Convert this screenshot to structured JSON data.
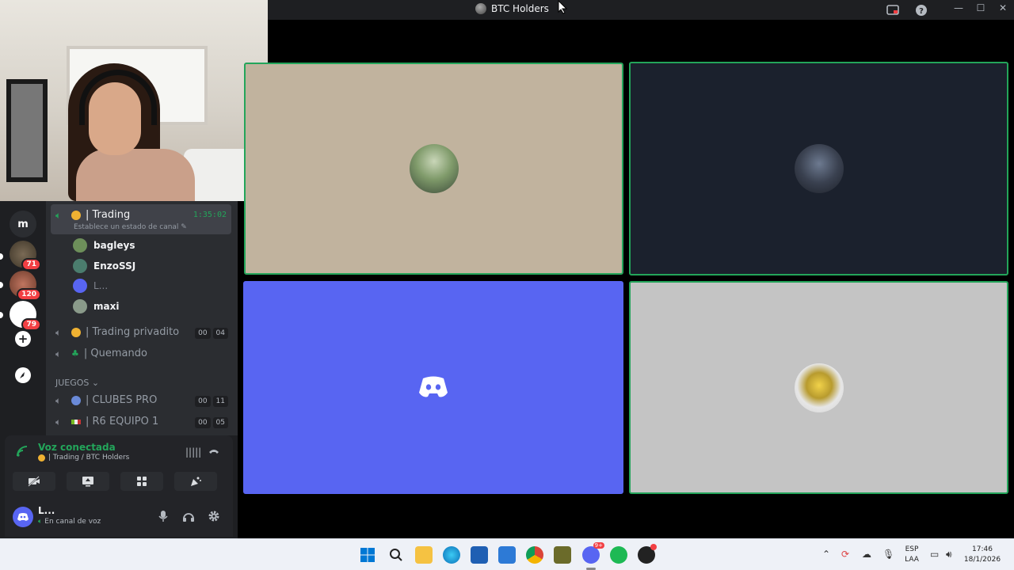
{
  "window": {
    "title": "BTC Holders"
  },
  "servers": [
    {
      "name": "server-m",
      "label": "m"
    },
    {
      "name": "server-71",
      "badge": "71"
    },
    {
      "name": "server-120",
      "badge": "120"
    },
    {
      "name": "server-79",
      "badge": "79"
    }
  ],
  "channels": {
    "active": {
      "name": "Trading",
      "timer": "1:35:02",
      "status": "Establece un estado de canal"
    },
    "users": [
      {
        "name": "bagleys",
        "color": "#6d8f5a"
      },
      {
        "name": "EnzoSSJ",
        "color": "#4b7d6e"
      },
      {
        "name": "L...",
        "color": "#5865f2"
      },
      {
        "name": "maxi",
        "color": "#8a9a8a"
      }
    ],
    "voice_private": {
      "name": "Trading privadito",
      "a": "00",
      "b": "04"
    },
    "voice_quemando": {
      "name": "Quemando"
    },
    "category": "JUEGOS",
    "clubes": {
      "name": "CLUBES PRO",
      "a": "00",
      "b": "11"
    },
    "r6": {
      "name": "R6 EQUIPO 1",
      "a": "00",
      "b": "05"
    }
  },
  "voice": {
    "status": "Voz conectada",
    "location": "| Trading / BTC Holders"
  },
  "user": {
    "name": "L...",
    "status": "En canal de voz"
  },
  "tray": {
    "lang1": "ESP",
    "lang2": "LAA",
    "time": "17:46",
    "date": "18/1/2026"
  },
  "taskbar": {
    "discord_badge": "9+"
  },
  "colors": {
    "accent_green": "#23a55a",
    "blurple": "#5865f2",
    "tile_tan": "#c1b39e",
    "tile_dark": "#1b212d",
    "tile_gray": "#c4c4c4"
  }
}
